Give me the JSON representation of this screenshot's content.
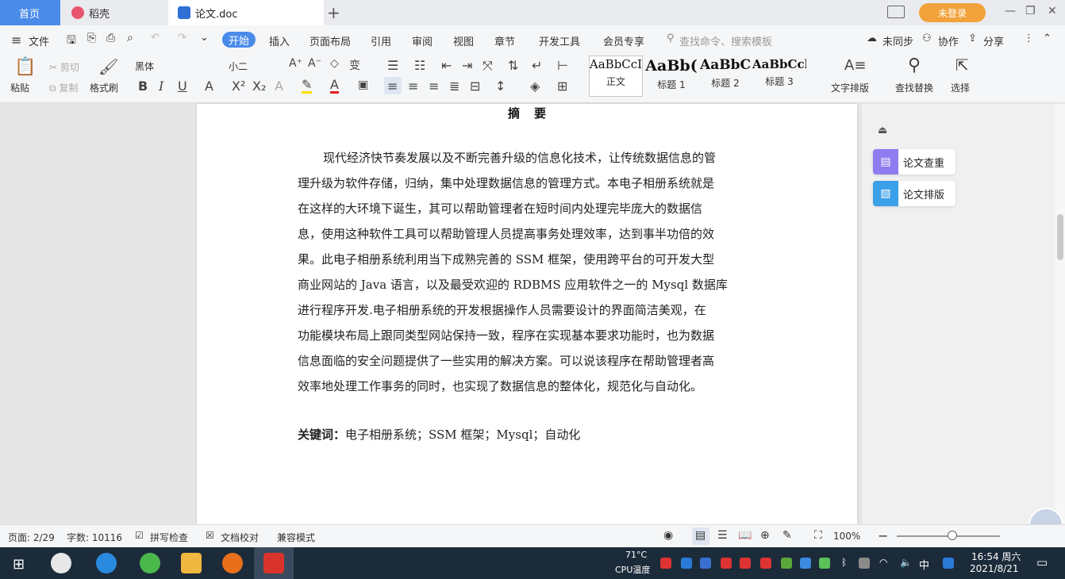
{
  "tabs": {
    "home": "首页",
    "doke": "稻壳",
    "doc": "论文.doc",
    "add": "+",
    "login": "未登录"
  },
  "menu": {
    "file": "文件",
    "start": "开始",
    "insert": "插入",
    "page_layout": "页面布局",
    "reference": "引用",
    "review": "审阅",
    "view": "视图",
    "chapter": "章节",
    "dev_tools": "开发工具",
    "member": "会员专享",
    "search_placeholder": "查找命令、搜索模板",
    "unsynced": "未同步",
    "collab": "协作",
    "share": "分享"
  },
  "ribbon": {
    "paste": "粘贴",
    "cut": "剪切",
    "copy": "复制",
    "format_painter": "格式刷",
    "font_name": "黑体",
    "font_size": "小二",
    "styles": [
      {
        "preview": "AaBbCcI",
        "name": "正文"
      },
      {
        "preview": "AaBb(",
        "name": "标题 1"
      },
      {
        "preview": "AaBbC",
        "name": "标题 2"
      },
      {
        "preview": "AaBbCcl",
        "name": "标题 3"
      }
    ],
    "text_layout": "文字排版",
    "find_replace": "查找替换",
    "select": "选择"
  },
  "document": {
    "heading": "摘要",
    "lines": [
      "现代经济快节奏发展以及不断完善升级的信息化技术，让传统数据信息的管",
      "理升级为软件存储，归纳，集中处理数据信息的管理方式。本电子相册系统就是",
      "在这样的大环境下诞生，其可以帮助管理者在短时间内处理完毕庞大的数据信",
      "息，使用这种软件工具可以帮助管理人员提高事务处理效率，达到事半功倍的效",
      "果。此电子相册系统利用当下成熟完善的 SSM 框架，使用跨平台的可开发大型",
      "商业网站的 Java 语言，以及最受欢迎的 RDBMS 应用软件之一的 Mysql 数据库",
      "进行程序开发.电子相册系统的开发根据操作人员需要设计的界面简洁美观，在",
      "功能模块布局上跟同类型网站保持一致，程序在实现基本要求功能时，也为数据",
      "信息面临的安全问题提供了一些实用的解决方案。可以说该程序在帮助管理者高",
      "效率地处理工作事务的同时，也实现了数据信息的整体化，规范化与自动化。"
    ],
    "keywords_label": "关键词：",
    "keywords": "电子相册系统；SSM 框架；Mysql；自动化"
  },
  "side_panel": {
    "check": "论文查重",
    "layout": "论文排版"
  },
  "status": {
    "page": "页面: 2/29",
    "words": "字数: 10116",
    "spell": "拼写检查",
    "proof": "文档校对",
    "compat": "兼容模式",
    "zoom": "100%"
  },
  "taskbar": {
    "temp": "71°C",
    "cpu": "CPU温度",
    "ime": "中",
    "time": "16:54 周六",
    "date": "2021/8/21"
  },
  "colors": {
    "accent": "#4a8bea",
    "login": "#f2a23b",
    "taskbar": "#1c2b3a"
  }
}
